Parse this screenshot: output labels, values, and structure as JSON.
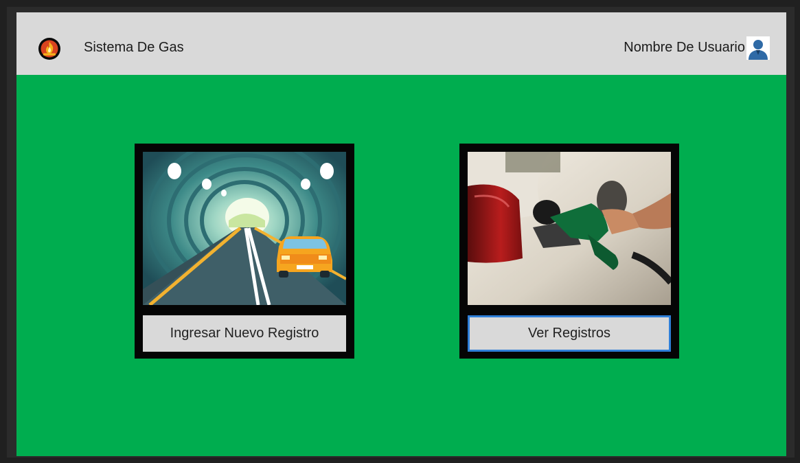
{
  "header": {
    "app_title": "Sistema De Gas",
    "user_name": "Nombre De Usuario",
    "logo_icon": "gas-flame-logo-icon",
    "avatar_icon": "user-avatar-icon"
  },
  "main": {
    "cards": [
      {
        "button_label": "Ingresar Nuevo Registro",
        "image": "car-in-tunnel-illustration"
      },
      {
        "button_label": "Ver Registros",
        "image": "fuel-nozzle-refueling-photo"
      }
    ]
  },
  "colors": {
    "background": "#00ad4f",
    "header": "#d9d9d9",
    "card_frame": "#050505",
    "focus_border": "#2f7fd8"
  }
}
